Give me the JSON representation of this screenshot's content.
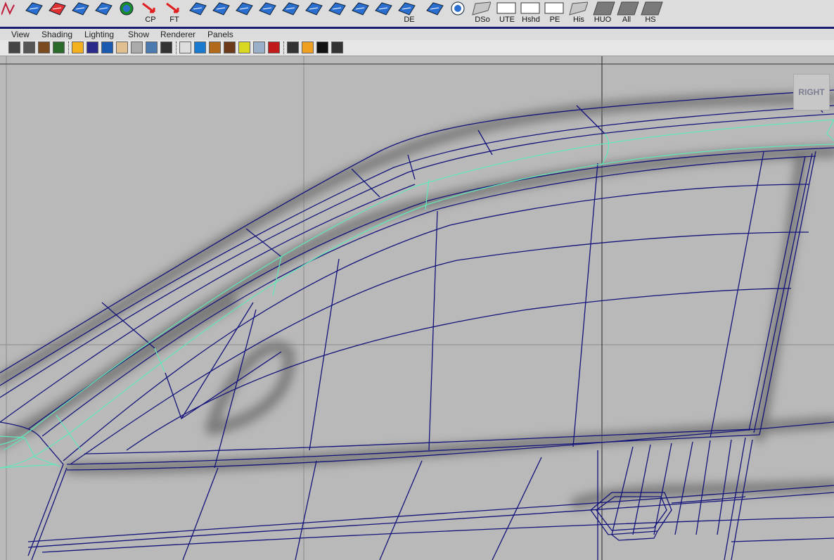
{
  "shelf": {
    "buttons": [
      {
        "id": "b1",
        "icon": "curve-icon",
        "color": "#c01a3a",
        "label": ""
      },
      {
        "id": "b2",
        "icon": "surface-fillet-icon",
        "color": "#2a6fd0",
        "label": ""
      },
      {
        "id": "b3",
        "icon": "revolve-icon",
        "color": "#e03030",
        "label": ""
      },
      {
        "id": "b4",
        "icon": "skin-surface-icon",
        "color": "#2a6fd0",
        "label": ""
      },
      {
        "id": "b5",
        "icon": "boundary-surface-icon",
        "color": "#2a6fd0",
        "label": ""
      },
      {
        "id": "b6",
        "icon": "sphere-icon",
        "color": "#1a8a2a",
        "label": ""
      },
      {
        "id": "b7",
        "icon": "cp-icon",
        "color": "#e02020",
        "label": "CP"
      },
      {
        "id": "b8",
        "icon": "ft-icon",
        "color": "#e02020",
        "label": "FT"
      },
      {
        "id": "b9",
        "icon": "extrude-icon",
        "color": "#2a6fd0",
        "label": ""
      },
      {
        "id": "b10",
        "icon": "square-surface-icon",
        "color": "#2a6fd0",
        "label": ""
      },
      {
        "id": "b11",
        "icon": "rail-surface-icon",
        "color": "#2a6fd0",
        "label": ""
      },
      {
        "id": "b12",
        "icon": "grid-surface-icon",
        "color": "#2a6fd0",
        "label": ""
      },
      {
        "id": "b13",
        "icon": "trim-icon",
        "color": "#2a6fd0",
        "label": ""
      },
      {
        "id": "b14",
        "icon": "align-icon",
        "color": "#2a6fd0",
        "label": ""
      },
      {
        "id": "b15",
        "icon": "offset-icon",
        "color": "#2a6fd0",
        "label": ""
      },
      {
        "id": "b16",
        "icon": "blend-icon",
        "color": "#2a6fd0",
        "label": ""
      },
      {
        "id": "b17",
        "icon": "intersect-icon",
        "color": "#2a6fd0",
        "label": ""
      },
      {
        "id": "b18",
        "icon": "de-icon",
        "color": "#2a6fd0",
        "label": "DE"
      },
      {
        "id": "b19",
        "icon": "group-icon",
        "color": "#2a6fd0",
        "label": ""
      },
      {
        "id": "b20",
        "icon": "orbit-icon",
        "color": "#2a6fd0",
        "label": ""
      },
      {
        "id": "b21",
        "icon": "dso-icon",
        "color": "#aaaaaa",
        "label": "DSo"
      },
      {
        "id": "b22",
        "icon": "ute-icon",
        "color": "#ffffff",
        "label": "UTE"
      },
      {
        "id": "b23",
        "icon": "hshd-icon",
        "color": "#ffffff",
        "label": "Hshd"
      },
      {
        "id": "b24",
        "icon": "pe-icon",
        "color": "#ffffff",
        "label": "PE"
      },
      {
        "id": "b25",
        "icon": "his-icon",
        "color": "#aaaaaa",
        "label": "His"
      },
      {
        "id": "b26",
        "icon": "huo-icon",
        "color": "#888888",
        "label": "HUO"
      },
      {
        "id": "b27",
        "icon": "all-icon",
        "color": "#888888",
        "label": "All"
      },
      {
        "id": "b28",
        "icon": "hs-icon",
        "color": "#888888",
        "label": "HS"
      }
    ]
  },
  "menubar": {
    "items": [
      "View",
      "Shading",
      "Lighting",
      "Show",
      "Renderer",
      "Panels"
    ]
  },
  "toolbar": {
    "icons": [
      "camera-icon",
      "camera-attr-icon",
      "bookmark-icon",
      "image-plane-icon",
      "grid-icon",
      "film-gate-icon",
      "resolution-gate-icon",
      "field-chart-icon",
      "wireframe-icon",
      "smooth-wire-icon",
      "texture-icon",
      "wireframe-cube-icon",
      "smooth-shade-icon",
      "flat-shade-icon",
      "textured-icon",
      "light-icon",
      "xray-icon",
      "shadow-icon",
      "isolate-select-icon",
      "frame-all-icon",
      "frame-selected-icon",
      "hud-icon"
    ]
  },
  "viewport": {
    "label": "RIGHT",
    "colors": {
      "background": "#b9b9b9",
      "wire": "#13137a",
      "selected_wire": "#5fe8b8",
      "shadow": "#6f6f6f"
    }
  }
}
